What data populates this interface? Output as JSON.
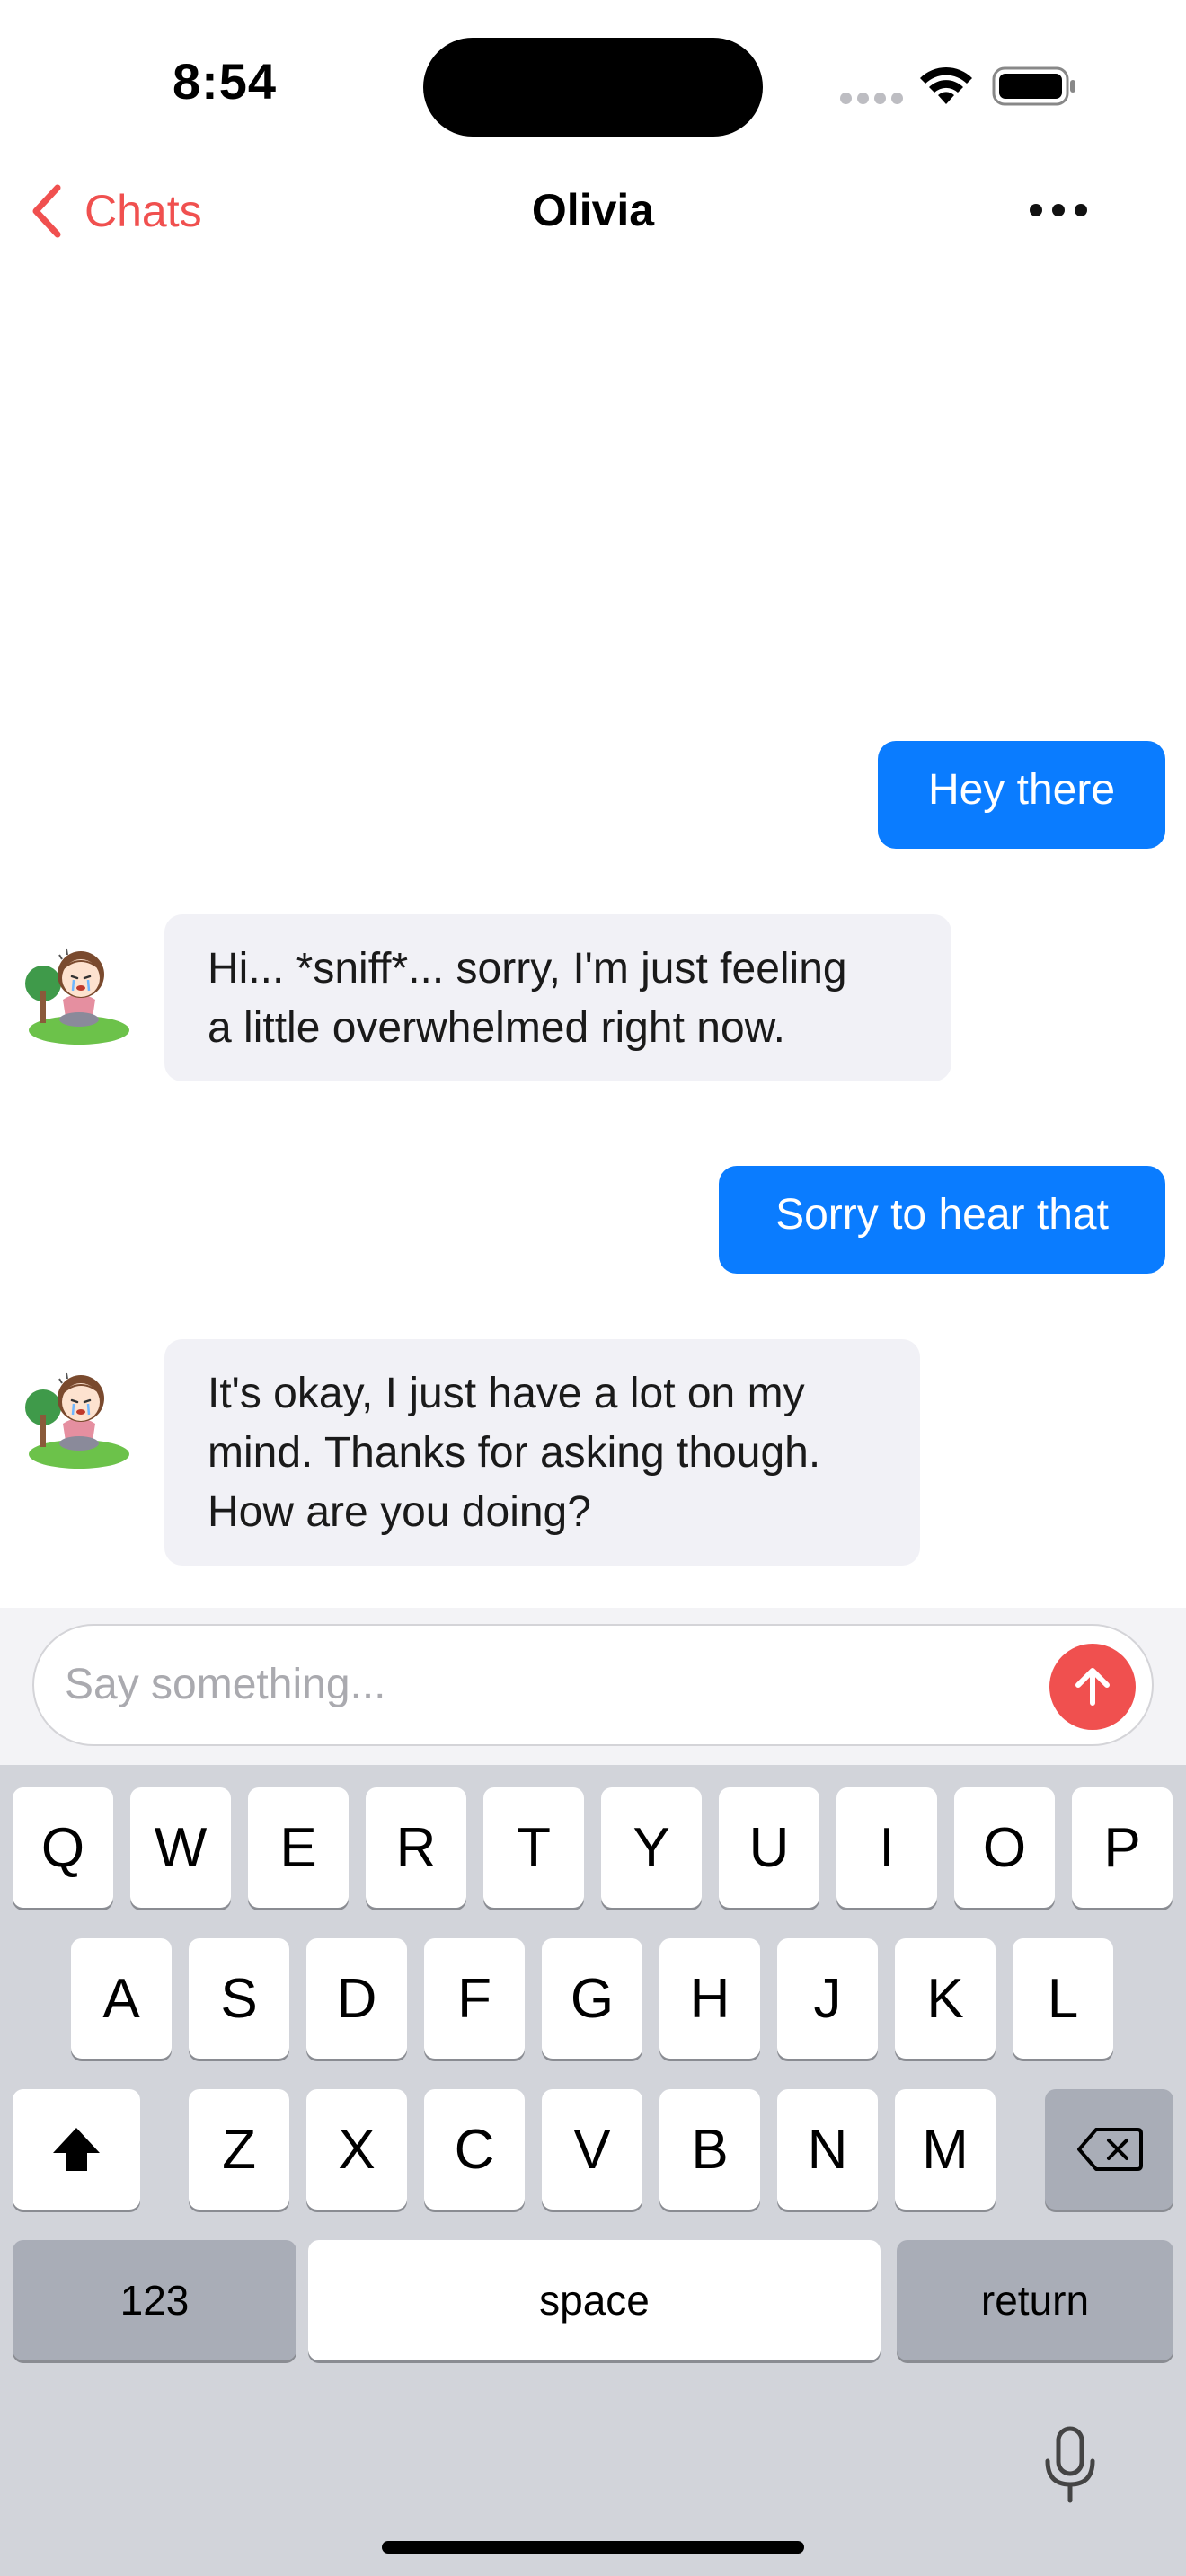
{
  "status_bar": {
    "time": "8:54"
  },
  "nav": {
    "back_label": "Chats",
    "title": "Olivia"
  },
  "messages": [
    {
      "from": "me",
      "text": "Hey there"
    },
    {
      "from": "Olivia",
      "lines": [
        "Hi... *sniff*... sorry, I'm just feeling",
        "a little overwhelmed right now."
      ]
    },
    {
      "from": "me",
      "text": "Sorry to hear that"
    },
    {
      "from": "Olivia",
      "lines": [
        "It's okay, I just have a lot on my",
        "mind. Thanks for asking though.",
        "How are you doing?"
      ]
    }
  ],
  "composer": {
    "placeholder": "Say something..."
  },
  "keyboard": {
    "row1": [
      "Q",
      "W",
      "E",
      "R",
      "T",
      "Y",
      "U",
      "I",
      "O",
      "P"
    ],
    "row2": [
      "A",
      "S",
      "D",
      "F",
      "G",
      "H",
      "J",
      "K",
      "L"
    ],
    "row3": [
      "Z",
      "X",
      "C",
      "V",
      "B",
      "N",
      "M"
    ],
    "numbers_label": "123",
    "space_label": "space",
    "return_label": "return"
  },
  "colors": {
    "accent": "#f0504f",
    "outgoing_bubble": "#0a7cff",
    "incoming_bubble": "#f1f1f6"
  },
  "icons": [
    "chevron-left-icon",
    "more-icon",
    "send-arrow-icon",
    "shift-icon",
    "delete-icon",
    "mic-icon",
    "wifi-icon",
    "battery-icon"
  ]
}
